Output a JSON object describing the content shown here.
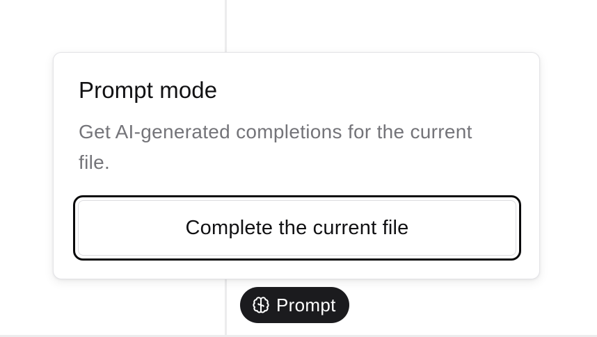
{
  "popover": {
    "title": "Prompt mode",
    "description": "Get AI-generated completions for the current file.",
    "action_label": "Complete the current file"
  },
  "mode_pill": {
    "icon": "brain-icon",
    "label": "Prompt"
  },
  "colors": {
    "pill_background": "#1b1b1e",
    "button_border": "#0a0a0b",
    "description_text": "#747479"
  }
}
